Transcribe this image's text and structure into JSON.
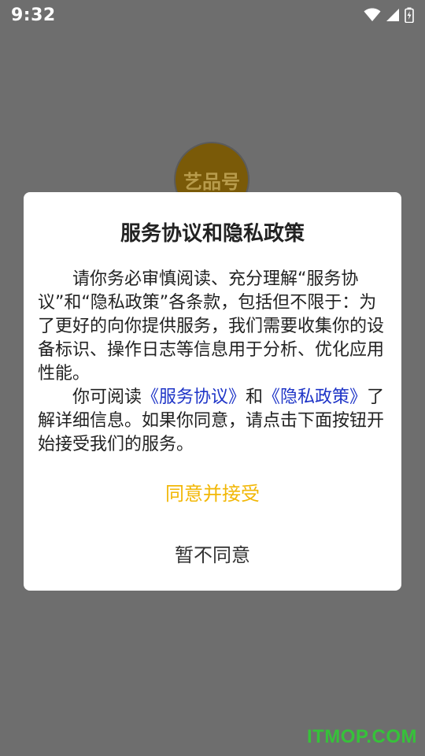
{
  "status_bar": {
    "time": "9:32",
    "icons": [
      "wifi-icon",
      "cellular-signal-icon",
      "battery-charging-icon"
    ],
    "color": "#ffffff"
  },
  "app_logo": {
    "text": "艺品号",
    "color": "#7a5a08"
  },
  "dialog": {
    "title": "服务协议和隐私政策",
    "paragraph1": "请你务必审慎阅读、充分理解“服务协议”和“隐私政策”各条款，包括但不限于：为了更好的向你提供服务，我们需要收集你的设备标识、操作日志等信息用于分析、优化应用性能。",
    "paragraph2_prefix": "你可阅读",
    "service_link": "《服务协议》",
    "paragraph2_and": "和",
    "privacy_link": "《隐私政策》",
    "paragraph2_suffix": "了解详细信息。如果你同意，请点击下面按钮开始接受我们的服务。",
    "agree_label": "同意并接受",
    "decline_label": "暂不同意",
    "agree_color": "#f2b705",
    "link_color": "#1e34c7"
  },
  "watermark": {
    "text": "ITMOP.COM",
    "color": "#36c23a"
  }
}
